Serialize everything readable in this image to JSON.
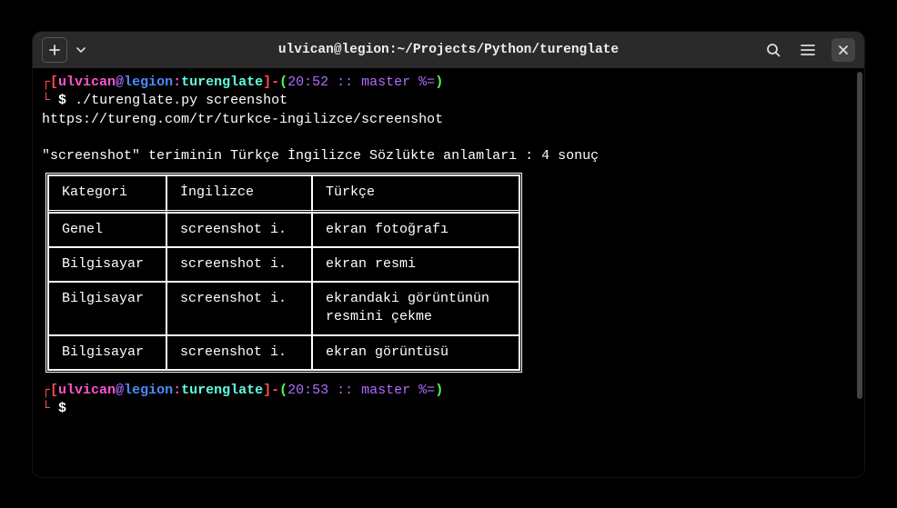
{
  "title": "ulvican@legion:~/Projects/Python/turenglate",
  "prompt1": {
    "user": "ulvican",
    "at": "@",
    "host": "legion",
    "colon": ":",
    "dir": "turenglate",
    "info": "20:52 :: master %=",
    "command": "./turenglate.py screenshot"
  },
  "output": {
    "url": "https://tureng.com/tr/turkce-ingilizce/screenshot",
    "summary": "\"screenshot\" teriminin Türkçe İngilizce Sözlükte anlamları : 4 sonuç"
  },
  "table": {
    "headers": {
      "cat": "Kategori",
      "eng": "İngilizce",
      "tur": "Türkçe"
    },
    "rows": [
      {
        "cat": "Genel",
        "eng": "screenshot i.",
        "tur": "ekran fotoğrafı"
      },
      {
        "cat": "Bilgisayar",
        "eng": "screenshot i.",
        "tur": "ekran resmi"
      },
      {
        "cat": "Bilgisayar",
        "eng": "screenshot i.",
        "tur": "ekrandaki görüntünün resmini çekme"
      },
      {
        "cat": "Bilgisayar",
        "eng": "screenshot i.",
        "tur": "ekran görüntüsü"
      }
    ]
  },
  "prompt2": {
    "user": "ulvican",
    "at": "@",
    "host": "legion",
    "colon": ":",
    "dir": "turenglate",
    "info": "20:53 :: master %=",
    "command": ""
  },
  "symbols": {
    "lbr": "[",
    "rbr": "]",
    "dash": "-",
    "lparen": "(",
    "rparen": ")",
    "dollar": "$",
    "corner": "└"
  }
}
